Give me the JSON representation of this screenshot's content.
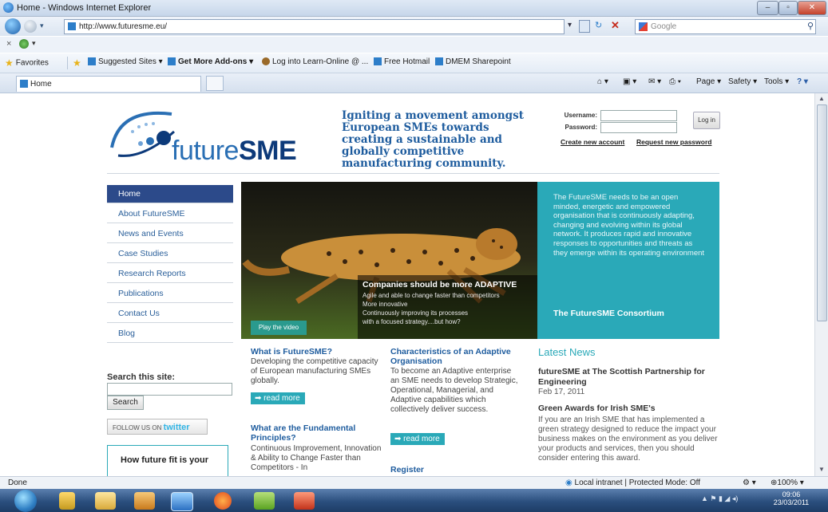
{
  "window": {
    "title": "Home - Windows Internet Explorer"
  },
  "nav": {
    "address": "http://www.futuresme.eu/",
    "search_placeholder": "Google"
  },
  "favorites": {
    "label": "Favorites",
    "items": [
      "Suggested Sites ▾",
      "Get More Add-ons ▾",
      "Log into Learn-Online @ ...",
      "Free Hotmail",
      "DMEM Sharepoint"
    ]
  },
  "tabs": {
    "active": "Home"
  },
  "commandbar": {
    "page": "Page ▾",
    "safety": "Safety ▾",
    "tools": "Tools ▾"
  },
  "site": {
    "logo_prefix": "future",
    "logo_bold": "SME",
    "tagline": "Igniting a movement amongst European SMEs towards creating a sustainable and globally competitive manufacturing community.",
    "login": {
      "username_label": "Username:",
      "password_label": "Password:",
      "button": "Log in",
      "create": "Create new account",
      "request": "Request new password"
    },
    "menu": [
      "Home",
      "About FutureSME",
      "News and Events",
      "Case Studies",
      "Research Reports",
      "Publications",
      "Contact Us",
      "Blog"
    ],
    "hero": {
      "caption_title": "Companies should be more ADAPTIVE",
      "caption_lines": [
        "Agile and able to change faster than competitors",
        "More innovative",
        "Continuously improving its processes",
        "with a focused strategy....but how?"
      ],
      "play": "Play the video"
    },
    "teal": {
      "text": "The FutureSME needs to be an open minded, energetic and empowered organisation that is continuously adapting, changing and evolving within its global network. It produces rapid and innovative responses to opportunities and threats as they emerge within its operating environment",
      "signature": "The FutureSME Consortium"
    },
    "col1": {
      "h1": "What is FutureSME?",
      "p1": "Developing the competitive capacity of European manufacturing SMEs globally.",
      "more": "read more",
      "h2": "What are the Fundamental Principles?",
      "p2": "Continuous Improvement, Innovation & Ability to Change Faster than Competitors - In"
    },
    "col2": {
      "h1": "Characteristics of an Adaptive Organisation",
      "p1": "To become an Adaptive enterprise an SME needs to develop Strategic, Operational, Managerial, and Adaptive capabilities which collectively deliver success.",
      "more": "read more",
      "h2": "Register"
    },
    "news": {
      "heading": "Latest News",
      "item1_title": "futureSME at The Scottish Partnership for Engineering",
      "item1_date": "Feb 17, 2011",
      "item2_title": "Green Awards for Irish SME's",
      "item2_text": "If you are an Irish SME that has implemented a green strategy designed to reduce the impact your business makes on the environment as you deliver your products and services, then you should consider entering this award."
    },
    "search": {
      "label": "Search this site:",
      "button": "Search"
    },
    "twitter": {
      "prefix": "FOLLOW US ON",
      "brand": "twitter"
    },
    "fit": {
      "text": "How future fit is your"
    }
  },
  "status": {
    "left": "Done",
    "zone": "Local intranet | Protected Mode: Off",
    "zoom": "100%"
  },
  "clock": {
    "time": "09:06",
    "date": "23/03/2011"
  }
}
